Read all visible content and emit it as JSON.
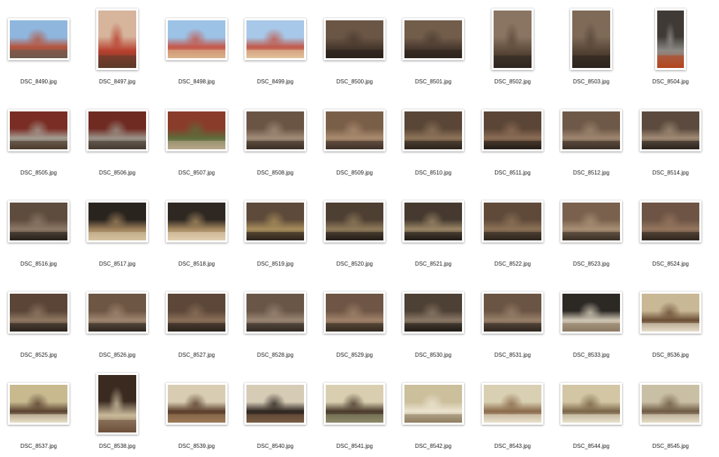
{
  "files": [
    {
      "name": "DSC_8490.jpg",
      "orient": "landscape",
      "colors": [
        "#8fb6dd",
        "#b5553f",
        "#6d5a4c"
      ]
    },
    {
      "name": "DSC_8497.jpg",
      "orient": "portrait",
      "colors": [
        "#d7b49c",
        "#b8402f",
        "#5b3a2a"
      ]
    },
    {
      "name": "DSC_8498.jpg",
      "orient": "landscape",
      "colors": [
        "#9cc2e6",
        "#c4574a",
        "#d9b38a"
      ]
    },
    {
      "name": "DSC_8499.jpg",
      "orient": "landscape",
      "colors": [
        "#a7c8e8",
        "#c0594b",
        "#e0c39a"
      ]
    },
    {
      "name": "DSC_8500.jpg",
      "orient": "landscape",
      "colors": [
        "#6b5646",
        "#4a3a2e",
        "#2a211b"
      ]
    },
    {
      "name": "DSC_8501.jpg",
      "orient": "landscape",
      "colors": [
        "#725d4b",
        "#4d3d31",
        "#2d241d"
      ]
    },
    {
      "name": "DSC_8502.jpg",
      "orient": "portrait",
      "colors": [
        "#8a7562",
        "#5e4b3b",
        "#2f2720"
      ]
    },
    {
      "name": "DSC_8503.jpg",
      "orient": "portrait",
      "colors": [
        "#7f6a58",
        "#564536",
        "#2c241e"
      ]
    },
    {
      "name": "DSC_8504.jpg",
      "orient": "tall",
      "colors": [
        "#3f3a35",
        "#8d8a86",
        "#b4451f"
      ]
    },
    {
      "name": "DSC_8505.jpg",
      "orient": "landscape",
      "colors": [
        "#7a2d24",
        "#a49c92",
        "#4b3b2c"
      ]
    },
    {
      "name": "DSC_8506.jpg",
      "orient": "landscape",
      "colors": [
        "#6f2a22",
        "#9b9288",
        "#463a30"
      ]
    },
    {
      "name": "DSC_8507.jpg",
      "orient": "landscape",
      "colors": [
        "#8a3c2a",
        "#5d6b3a",
        "#b8a78a"
      ]
    },
    {
      "name": "DSC_8508.jpg",
      "orient": "landscape",
      "colors": [
        "#6a5545",
        "#a18c78",
        "#3a2e25"
      ]
    },
    {
      "name": "DSC_8509.jpg",
      "orient": "landscape",
      "colors": [
        "#7a5f48",
        "#a98b6f",
        "#3e3027"
      ]
    },
    {
      "name": "DSC_8510.jpg",
      "orient": "landscape",
      "colors": [
        "#5a4637",
        "#8d7459",
        "#2b231c"
      ]
    },
    {
      "name": "DSC_8511.jpg",
      "orient": "landscape",
      "colors": [
        "#5b4536",
        "#8b6d55",
        "#241d18"
      ]
    },
    {
      "name": "DSC_8512.jpg",
      "orient": "landscape",
      "colors": [
        "#6e5847",
        "#9e8670",
        "#3a2e25"
      ]
    },
    {
      "name": "DSC_8514.jpg",
      "orient": "landscape",
      "colors": [
        "#5b4a3d",
        "#a08a74",
        "#2a221c"
      ]
    },
    {
      "name": "DSC_8516.jpg",
      "orient": "landscape",
      "colors": [
        "#5e4c3e",
        "#8e7967",
        "#26201a"
      ]
    },
    {
      "name": "DSC_8517.jpg",
      "orient": "landscape",
      "colors": [
        "#2a241f",
        "#9c7f5a",
        "#d6c3a1"
      ]
    },
    {
      "name": "DSC_8518.jpg",
      "orient": "landscape",
      "colors": [
        "#2f2822",
        "#a4875f",
        "#e1d0b0"
      ]
    },
    {
      "name": "DSC_8519.jpg",
      "orient": "landscape",
      "colors": [
        "#5e4a3a",
        "#a78d5c",
        "#2b231c"
      ]
    },
    {
      "name": "DSC_8520.jpg",
      "orient": "landscape",
      "colors": [
        "#4e3f33",
        "#8f7a5a",
        "#221c17"
      ]
    },
    {
      "name": "DSC_8521.jpg",
      "orient": "landscape",
      "colors": [
        "#463a30",
        "#9a8566",
        "#1f1a16"
      ]
    },
    {
      "name": "DSC_8522.jpg",
      "orient": "landscape",
      "colors": [
        "#5f4a3a",
        "#8c7257",
        "#2c241d"
      ]
    },
    {
      "name": "DSC_8523.jpg",
      "orient": "landscape",
      "colors": [
        "#7a614d",
        "#a98f75",
        "#3a2f26"
      ]
    },
    {
      "name": "DSC_8524.jpg",
      "orient": "landscape",
      "colors": [
        "#6d5444",
        "#95765e",
        "#2f261f"
      ]
    },
    {
      "name": "DSC_8525.jpg",
      "orient": "landscape",
      "colors": [
        "#5a4537",
        "#8f7762",
        "#2a221b"
      ]
    },
    {
      "name": "DSC_8526.jpg",
      "orient": "landscape",
      "colors": [
        "#6e5645",
        "#9f8670",
        "#2e261f"
      ]
    },
    {
      "name": "DSC_8527.jpg",
      "orient": "landscape",
      "colors": [
        "#5c4738",
        "#8a6f58",
        "#2a221c"
      ]
    },
    {
      "name": "DSC_8528.jpg",
      "orient": "landscape",
      "colors": [
        "#6a5647",
        "#9a8573",
        "#322a22"
      ]
    },
    {
      "name": "DSC_8529.jpg",
      "orient": "landscape",
      "colors": [
        "#6e5545",
        "#a0826a",
        "#33291f"
      ]
    },
    {
      "name": "DSC_8530.jpg",
      "orient": "landscape",
      "colors": [
        "#4d4035",
        "#8a7866",
        "#201b16"
      ]
    },
    {
      "name": "DSC_8531.jpg",
      "orient": "landscape",
      "colors": [
        "#6a5443",
        "#98806a",
        "#2f261f"
      ]
    },
    {
      "name": "DSC_8533.jpg",
      "orient": "landscape",
      "colors": [
        "#2c2824",
        "#cfc6b4",
        "#8c7a62"
      ]
    },
    {
      "name": "DSC_8536.jpg",
      "orient": "landscape",
      "colors": [
        "#c9b896",
        "#6b4e34",
        "#e5dcc8"
      ]
    },
    {
      "name": "DSC_8537.jpg",
      "orient": "landscape",
      "colors": [
        "#c8b98f",
        "#5a4330",
        "#e8dfc6"
      ]
    },
    {
      "name": "DSC_8538.jpg",
      "orient": "portrait",
      "colors": [
        "#3a2a20",
        "#c9b99a",
        "#6b4f3a"
      ]
    },
    {
      "name": "DSC_8539.jpg",
      "orient": "landscape",
      "colors": [
        "#d8cdb3",
        "#5b3f2c",
        "#9c7a58"
      ]
    },
    {
      "name": "DSC_8540.jpg",
      "orient": "landscape",
      "colors": [
        "#d6ccb6",
        "#2e2520",
        "#7a5d44"
      ]
    },
    {
      "name": "DSC_8541.jpg",
      "orient": "landscape",
      "colors": [
        "#d9cfb0",
        "#4a3a2c",
        "#8c8a6a"
      ]
    },
    {
      "name": "DSC_8542.jpg",
      "orient": "landscape",
      "colors": [
        "#cbbf9c",
        "#ece4d0",
        "#8f7e60"
      ]
    },
    {
      "name": "DSC_8543.jpg",
      "orient": "landscape",
      "colors": [
        "#d9cfb2",
        "#8a6a4a",
        "#eae2cd"
      ]
    },
    {
      "name": "DSC_8544.jpg",
      "orient": "landscape",
      "colors": [
        "#d2c6a4",
        "#7a6548",
        "#e9e1cc"
      ]
    },
    {
      "name": "DSC_8545.jpg",
      "orient": "landscape",
      "colors": [
        "#c9bfa4",
        "#6e5a44",
        "#e6ddc6"
      ]
    }
  ]
}
